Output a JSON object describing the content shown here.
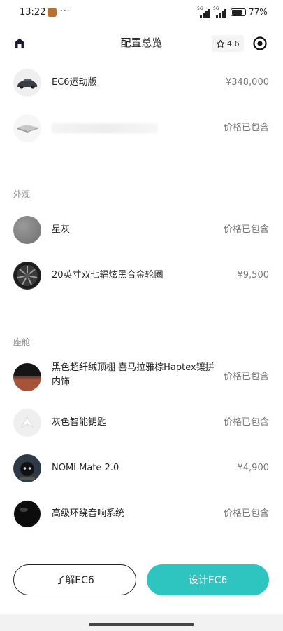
{
  "status_bar": {
    "time": "13:22",
    "dots": "···",
    "net_left": "5G",
    "net_right": "5G",
    "battery_text": "77%"
  },
  "header": {
    "title": "配置总览",
    "rating": "4.6",
    "icons": [
      "home-icon",
      "star-icon",
      "target-icon"
    ]
  },
  "top_items": [
    {
      "name": "EC6运动版",
      "price": "¥348,000"
    },
    {
      "name": "",
      "price": "价格已包含"
    }
  ],
  "sections": [
    {
      "title": "外观",
      "items": [
        {
          "name": "星灰",
          "price": "价格已包含"
        },
        {
          "name": "20英寸双七辐炫黑合金轮圈",
          "price": "¥9,500"
        }
      ]
    },
    {
      "title": "座舱",
      "items": [
        {
          "name": "黑色超纤绒顶棚 喜马拉雅棕Haptex镶拼内饰",
          "price": "价格已包含"
        },
        {
          "name": "灰色智能钥匙",
          "price": "价格已包含"
        },
        {
          "name": "NOMI Mate 2.0",
          "price": "¥4,900"
        },
        {
          "name": "高级环绕音响系统",
          "price": "价格已包含"
        }
      ]
    }
  ],
  "buttons": {
    "learn": "了解EC6",
    "design": "设计EC6"
  },
  "colors": {
    "accent": "#2ec4c0",
    "text": "#222222",
    "muted": "#777777"
  }
}
